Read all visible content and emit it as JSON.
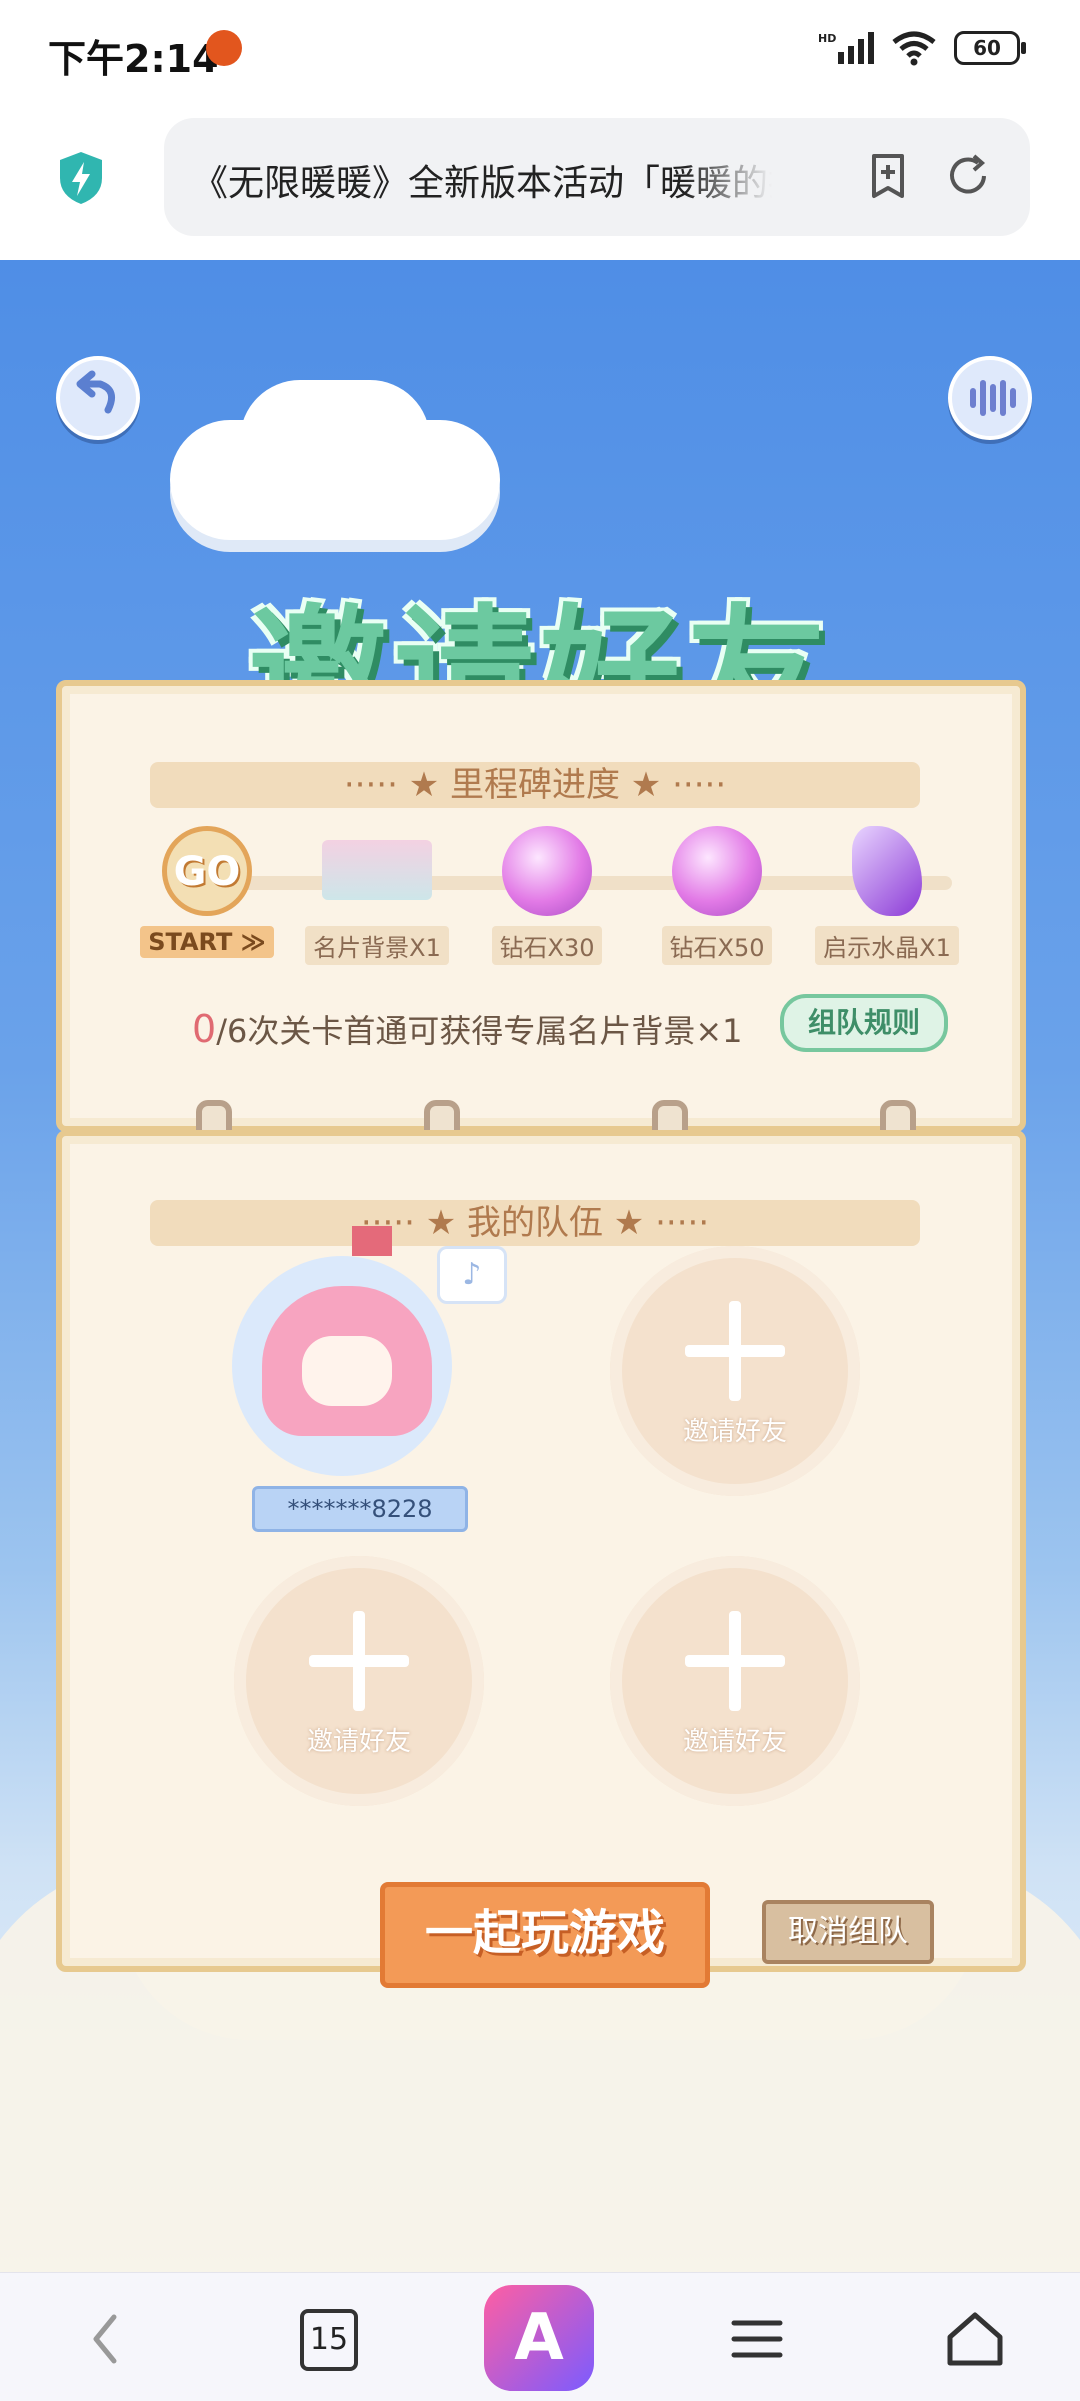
{
  "status_bar": {
    "time": "下午2:14",
    "battery": "60",
    "network": "HD"
  },
  "browser": {
    "url_title": "《无限暖暖》全新版本活动「暖暖的拍",
    "icons": [
      "shield-lightning-icon",
      "add-bookmark-icon",
      "refresh-icon"
    ]
  },
  "game": {
    "title": "邀请好友",
    "milestone_header": "····· ★ 里程碑进度 ★ ·····",
    "milestones": [
      {
        "icon": "go-icon",
        "label": "START ≫"
      },
      {
        "icon": "card-background-icon",
        "label": "名片背景X1"
      },
      {
        "icon": "diamond-icon",
        "label": "钻石X30"
      },
      {
        "icon": "diamond-icon",
        "label": "钻石X50"
      },
      {
        "icon": "crystal-icon",
        "label": "启示水晶X1"
      }
    ],
    "progress_count": "0",
    "progress_text": "/6次关卡首通可获得专属名片背景×1",
    "rules_button": "组队规则",
    "team_header": "····· ★ 我的队伍 ★ ·····",
    "member": {
      "name": "*******8228",
      "note_icon": "♪"
    },
    "invite_label": "邀请好友",
    "play_button": "一起玩游戏",
    "cancel_button": "取消组队",
    "accent_colors": {
      "title_green": "#6cc9a0",
      "play_orange": "#f39a57",
      "panel_cream": "#fbf3e6"
    }
  },
  "bottom_nav": {
    "tab_count": "15",
    "ai_label": "A",
    "icons": [
      "back-chevron-icon",
      "tabs-icon",
      "ai-assistant-icon",
      "menu-icon",
      "home-icon"
    ]
  }
}
